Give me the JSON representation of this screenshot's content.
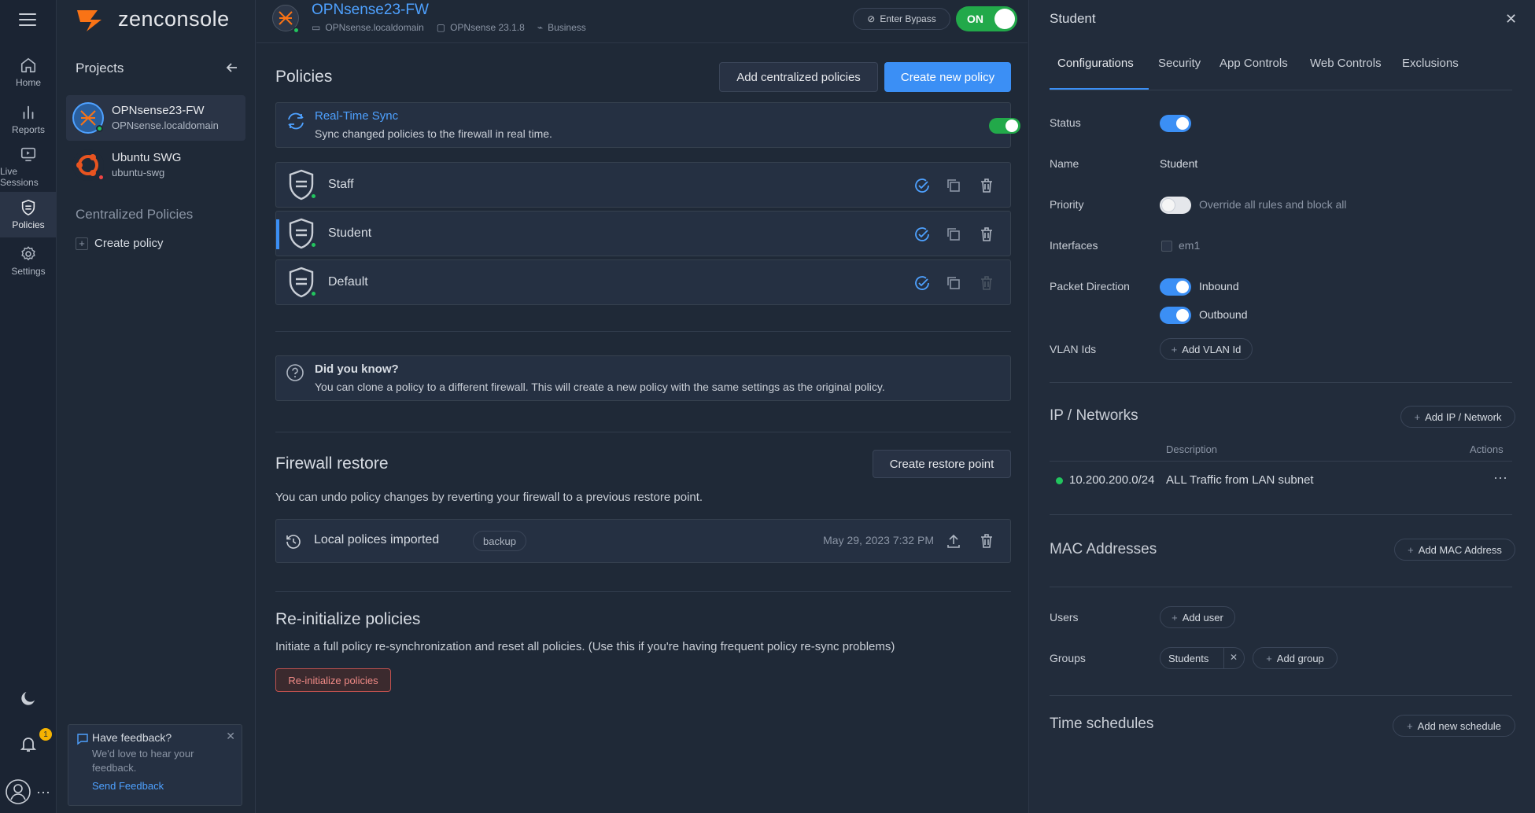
{
  "app": {
    "logo_text": "zenconsole"
  },
  "rail": {
    "items": [
      {
        "label": "Home"
      },
      {
        "label": "Reports"
      },
      {
        "label": "Live Sessions"
      },
      {
        "label": "Policies"
      },
      {
        "label": "Settings"
      }
    ],
    "notification_count": "1"
  },
  "header": {
    "device_name": "OPNsense23-FW",
    "hostname": "OPNsense.localdomain",
    "version": "OPNsense 23.1.8",
    "plan": "Business",
    "bypass_label": "Enter Bypass",
    "power_label": "ON"
  },
  "sidebar": {
    "title": "Projects",
    "projects": [
      {
        "name": "OPNsense23-FW",
        "host": "OPNsense.localdomain",
        "status_color": "#22c55e"
      },
      {
        "name": "Ubuntu SWG",
        "host": "ubuntu-swg",
        "status_color": "#ef4444"
      }
    ],
    "centralized_title": "Centralized Policies",
    "create_policy": "Create policy",
    "feedback": {
      "title": "Have feedback?",
      "body": "We'd love to hear your feedback.",
      "link": "Send Feedback"
    }
  },
  "main": {
    "policies_title": "Policies",
    "add_centralized": "Add centralized policies",
    "create_new": "Create new policy",
    "sync": {
      "title": "Real-Time Sync",
      "desc": "Sync changed policies to the firewall in real time."
    },
    "policies": [
      {
        "name": "Staff"
      },
      {
        "name": "Student"
      },
      {
        "name": "Default"
      }
    ],
    "tip": {
      "title": "Did you know?",
      "body": "You can clone a policy to a different firewall. This will create a new policy with the same settings as the original policy."
    },
    "restore": {
      "title": "Firewall restore",
      "button": "Create restore point",
      "desc": "You can undo policy changes by reverting your firewall to a previous restore point.",
      "item_name": "Local polices imported",
      "item_tag": "backup",
      "item_date": "May 29, 2023 7:32 PM"
    },
    "reinit": {
      "title": "Re-initialize policies",
      "desc": "Initiate a full policy re-synchronization and reset all policies. (Use this if you're having frequent policy re-sync problems)",
      "button": "Re-initialize policies"
    }
  },
  "panel": {
    "title": "Student",
    "tabs": [
      "Configurations",
      "Security",
      "App Controls",
      "Web Controls",
      "Exclusions"
    ],
    "labels": {
      "status": "Status",
      "name": "Name",
      "priority": "Priority",
      "interfaces": "Interfaces",
      "packet_direction": "Packet Direction",
      "vlan": "VLAN Ids",
      "users": "Users",
      "groups": "Groups"
    },
    "name_value": "Student",
    "priority_text": "Override all rules and block all",
    "interface_value": "em1",
    "inbound": "Inbound",
    "outbound": "Outbound",
    "add_vlan": "Add VLAN Id",
    "ip_title": "IP / Networks",
    "add_ip": "Add IP / Network",
    "ip_cols": {
      "description": "Description",
      "actions": "Actions"
    },
    "ip_rows": [
      {
        "network": "10.200.200.0/24",
        "description": "ALL Traffic from LAN subnet"
      }
    ],
    "mac_title": "MAC Addresses",
    "add_mac": "Add MAC Address",
    "add_user": "Add user",
    "group_tag": "Students",
    "add_group": "Add group",
    "time_title": "Time schedules",
    "add_schedule": "Add new schedule"
  },
  "colors": {
    "accent": "#3b8ff5",
    "success": "#22c55e",
    "danger": "#ef4444",
    "brand": "#f97316"
  }
}
